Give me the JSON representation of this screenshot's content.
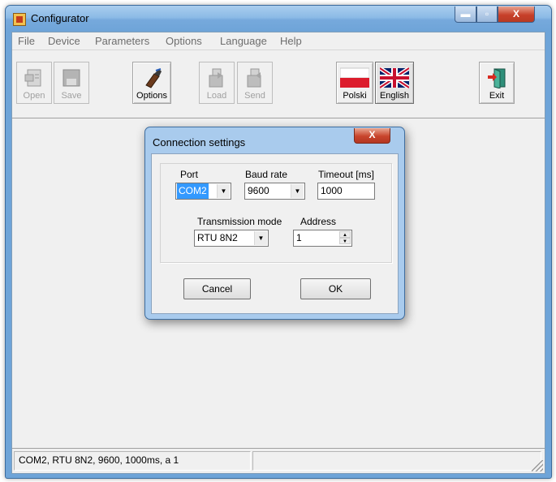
{
  "window": {
    "title": "Configurator",
    "minimize_glyph": "▬",
    "maximize_glyph": "▫",
    "close_glyph": "X"
  },
  "menu": {
    "items": [
      "File",
      "Device",
      "Parameters",
      "Options",
      "Language",
      "Help"
    ]
  },
  "toolbar": {
    "open": {
      "label": "Open",
      "icon": "open-icon"
    },
    "save": {
      "label": "Save",
      "icon": "save-icon"
    },
    "options": {
      "label": "Options",
      "icon": "options-icon"
    },
    "load": {
      "label": "Load",
      "icon": "load-icon"
    },
    "send": {
      "label": "Send",
      "icon": "send-icon"
    },
    "polski": {
      "label": "Polski",
      "icon": "polish-flag-icon"
    },
    "english": {
      "label": "English",
      "icon": "uk-flag-icon"
    },
    "exit": {
      "label": "Exit",
      "icon": "exit-door-icon"
    }
  },
  "dialog": {
    "title": "Connection settings",
    "close_glyph": "X",
    "port": {
      "label": "Port",
      "value": "COM2"
    },
    "baud": {
      "label": "Baud rate",
      "value": "9600"
    },
    "timeout": {
      "label": "Timeout [ms]",
      "value": "1000"
    },
    "mode": {
      "label": "Transmission mode",
      "value": "RTU 8N2"
    },
    "address": {
      "label": "Address",
      "value": "1"
    },
    "cancel_label": "Cancel",
    "ok_label": "OK"
  },
  "status": {
    "text": "COM2, RTU 8N2, 9600, 1000ms, a 1"
  },
  "colors": {
    "title_bar": "#6ea4d8",
    "close_button": "#c8442c",
    "selection": "#3399ff"
  }
}
